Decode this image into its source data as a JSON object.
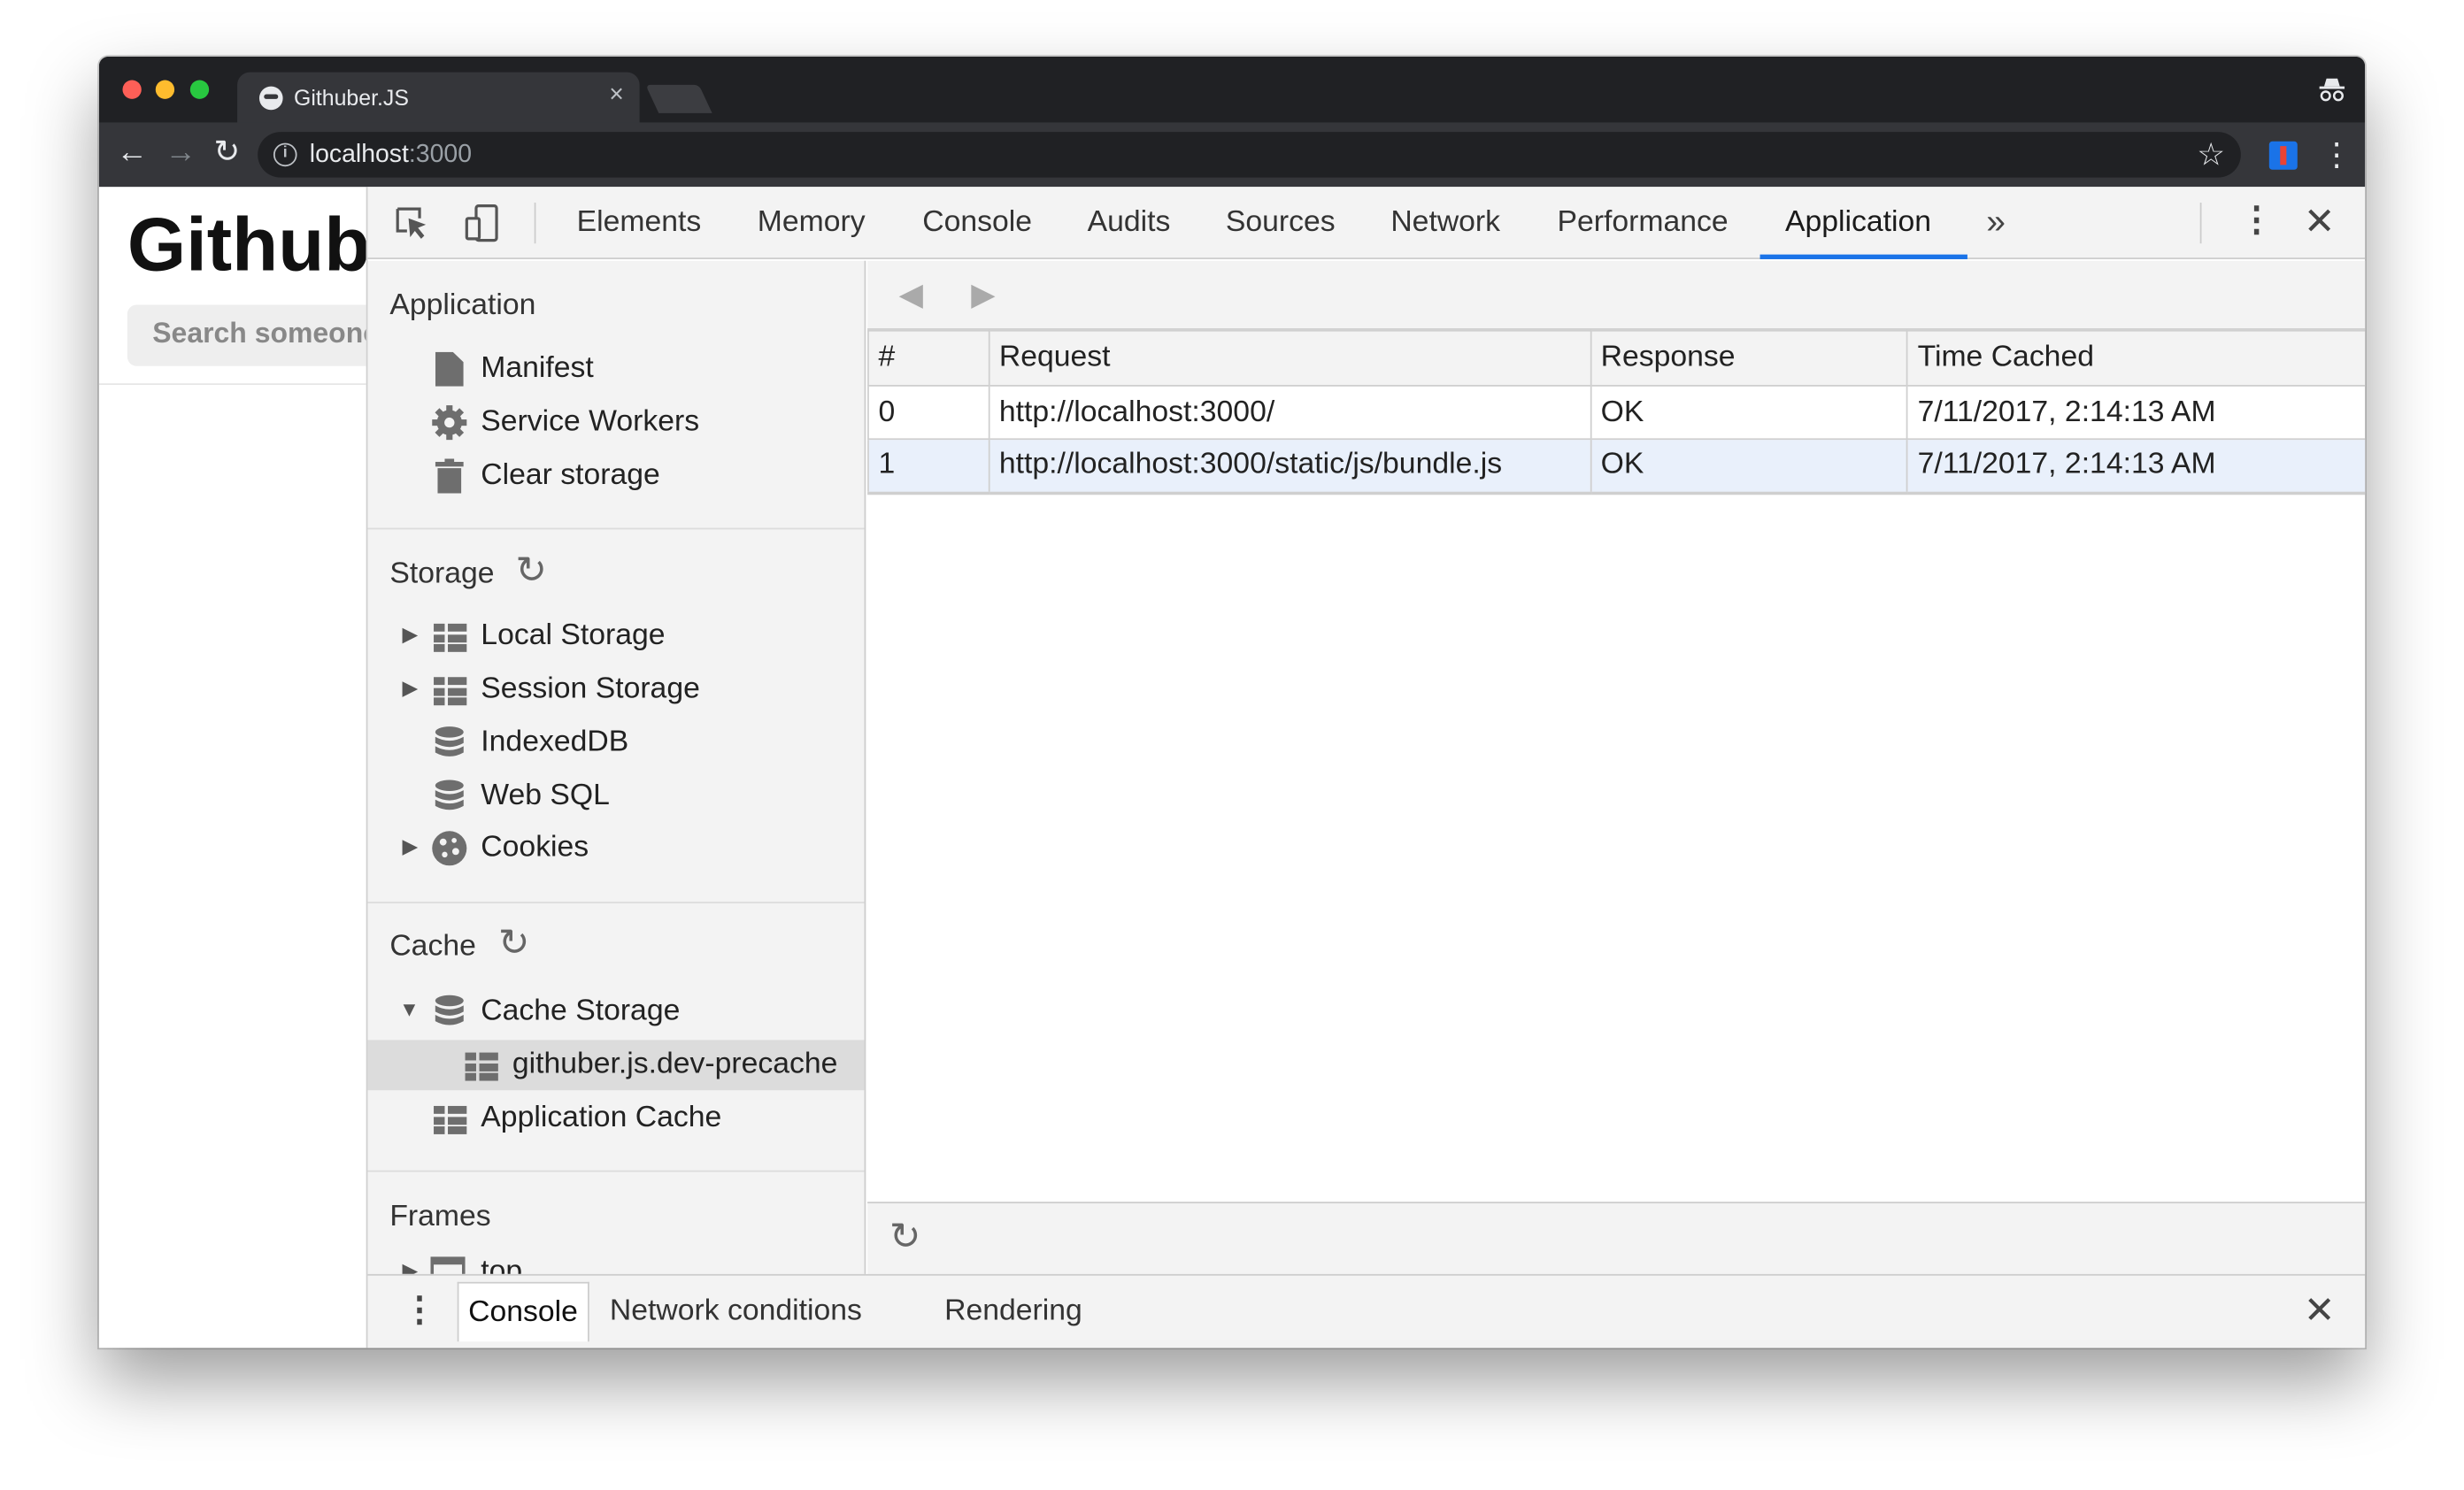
{
  "browser": {
    "tab_title": "Githuber.JS",
    "tab_close": "×",
    "url_host": "localhost",
    "url_port": ":3000",
    "back_glyph": "←",
    "forward_glyph": "→",
    "reload_glyph": "↻",
    "star_glyph": "☆",
    "menu_glyph": "⋮"
  },
  "page": {
    "title": "Githuber.JS",
    "search_placeholder": "Search someone..."
  },
  "devtools": {
    "tabs": [
      "Elements",
      "Memory",
      "Console",
      "Audits",
      "Sources",
      "Network",
      "Performance",
      "Application"
    ],
    "active_tab": "Application",
    "more_glyph": "»",
    "kebab_glyph": "⋮",
    "close_glyph": "✕",
    "accent_color": "#1a73e8"
  },
  "sidebar": {
    "application": {
      "title": "Application",
      "items": [
        "Manifest",
        "Service Workers",
        "Clear storage"
      ]
    },
    "storage": {
      "title": "Storage",
      "items": [
        "Local Storage",
        "Session Storage",
        "IndexedDB",
        "Web SQL",
        "Cookies"
      ]
    },
    "cache": {
      "title": "Cache",
      "cache_storage": "Cache Storage",
      "cache_entry": "githuber.js.dev-precache",
      "application_cache": "Application Cache"
    },
    "frames": {
      "title": "Frames",
      "first_item": "top"
    }
  },
  "cache_table": {
    "columns": [
      "#",
      "Request",
      "Response",
      "Time Cached"
    ],
    "rows": [
      [
        "0",
        "http://localhost:3000/",
        "OK",
        "7/11/2017, 2:14:13 AM"
      ],
      [
        "1",
        "http://localhost:3000/static/js/bundle.js",
        "OK",
        "7/11/2017, 2:14:13 AM"
      ]
    ],
    "selected_row_color": "#e9f0fb"
  },
  "drawer": {
    "tabs": [
      "Console",
      "Network conditions",
      "Rendering"
    ],
    "active_tab": "Console",
    "close_glyph": "✕",
    "kebab_glyph": "⋮"
  }
}
